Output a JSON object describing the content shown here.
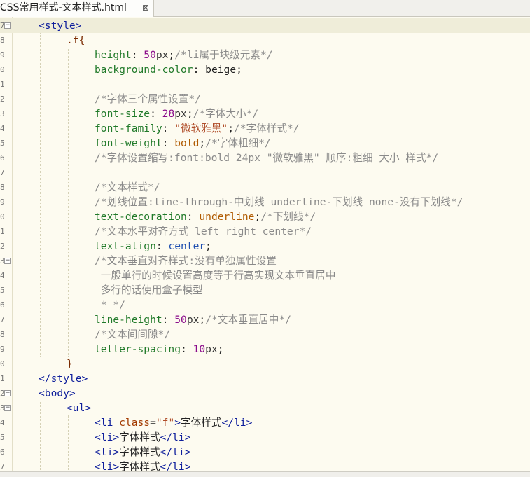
{
  "tab": {
    "title": "CSS常用样式-文本样式.html",
    "close": "⊠"
  },
  "lines": [
    [
      [
        "tag",
        "<style>"
      ]
    ],
    [
      [
        "sel",
        ".f{"
      ]
    ],
    [
      [
        "prop",
        "height"
      ],
      [
        "text",
        ": "
      ],
      [
        "num",
        "50"
      ],
      [
        "unit",
        "px"
      ],
      [
        "text",
        ";"
      ],
      [
        "com",
        "/*li属于块级元素*/"
      ]
    ],
    [
      [
        "prop",
        "background-color"
      ],
      [
        "text",
        ": "
      ],
      [
        "text",
        "beige;"
      ]
    ],
    [],
    [
      [
        "com",
        "/*字体三个属性设置*/"
      ]
    ],
    [
      [
        "prop",
        "font-size"
      ],
      [
        "text",
        ": "
      ],
      [
        "num",
        "28"
      ],
      [
        "unit",
        "px"
      ],
      [
        "text",
        ";"
      ],
      [
        "com",
        "/*字体大小*/"
      ]
    ],
    [
      [
        "prop",
        "font-family"
      ],
      [
        "text",
        ": "
      ],
      [
        "str",
        "\"微软雅黑\""
      ],
      [
        "text",
        ";"
      ],
      [
        "com",
        "/*字体样式*/"
      ]
    ],
    [
      [
        "prop",
        "font-weight"
      ],
      [
        "text",
        ": "
      ],
      [
        "kw",
        "bold"
      ],
      [
        "text",
        ";"
      ],
      [
        "com",
        "/*字体粗细*/"
      ]
    ],
    [
      [
        "com",
        "/*字体设置缩写:font:bold 24px \"微软雅黑\" 顺序:粗细 大小 样式*/"
      ]
    ],
    [],
    [
      [
        "com",
        "/*文本样式*/"
      ]
    ],
    [
      [
        "com",
        "/*划线位置:line-through-中划线 underline-下划线 none-没有下划线*/"
      ]
    ],
    [
      [
        "prop",
        "text-decoration"
      ],
      [
        "text",
        ": "
      ],
      [
        "kw",
        "underline"
      ],
      [
        "text",
        ";"
      ],
      [
        "com",
        "/*下划线*/"
      ]
    ],
    [
      [
        "com",
        "/*文本水平对齐方式 left right center*/"
      ]
    ],
    [
      [
        "prop",
        "text-align"
      ],
      [
        "text",
        ": "
      ],
      [
        "kw2",
        "center"
      ],
      [
        "text",
        ";"
      ]
    ],
    [
      [
        "com",
        "/*文本垂直对齐样式:没有单独属性设置"
      ]
    ],
    [
      [
        "com",
        " 一般单行的时候设置高度等于行高实现文本垂直居中"
      ]
    ],
    [
      [
        "com",
        " 多行的话使用盒子模型"
      ]
    ],
    [
      [
        "com",
        " * */"
      ]
    ],
    [
      [
        "prop",
        "line-height"
      ],
      [
        "text",
        ": "
      ],
      [
        "num",
        "50"
      ],
      [
        "unit",
        "px"
      ],
      [
        "text",
        ";"
      ],
      [
        "com",
        "/*文本垂直居中*/"
      ]
    ],
    [
      [
        "com",
        "/*文本间间隙*/"
      ]
    ],
    [
      [
        "prop",
        "letter-spacing"
      ],
      [
        "text",
        ": "
      ],
      [
        "num",
        "10"
      ],
      [
        "unit",
        "px"
      ],
      [
        "text",
        ";"
      ]
    ],
    [
      [
        "sel",
        "}"
      ]
    ],
    [
      [
        "tag",
        "</style>"
      ]
    ],
    [
      [
        "tag",
        "<body>"
      ]
    ],
    [
      [
        "tag",
        "<ul>"
      ]
    ],
    [
      [
        "tag",
        "<li "
      ],
      [
        "attr",
        "class"
      ],
      [
        "text",
        "="
      ],
      [
        "str",
        "\"f\""
      ],
      [
        "tag",
        ">"
      ],
      [
        "text",
        "字体样式"
      ],
      [
        "tag",
        "</li>"
      ]
    ],
    [
      [
        "tag",
        "<li>"
      ],
      [
        "text",
        "字体样式"
      ],
      [
        "tag",
        "</li>"
      ]
    ],
    [
      [
        "tag",
        "<li>"
      ],
      [
        "text",
        "字体样式"
      ],
      [
        "tag",
        "</li>"
      ]
    ],
    [
      [
        "tag",
        "<li>"
      ],
      [
        "text",
        "字体样式"
      ],
      [
        "tag",
        "</li>"
      ]
    ]
  ],
  "gutter_numbers": [
    "7",
    "8",
    "9",
    "0",
    "1",
    "2",
    "3",
    "4",
    "5",
    "6",
    "7",
    "8",
    "9",
    "0",
    "1",
    "2",
    "3",
    "4",
    "5",
    "6",
    "7",
    "8",
    "9",
    "0",
    "1",
    "2",
    "3",
    "4",
    "5",
    "6",
    "7"
  ],
  "fold_markers": [
    "⊟",
    "",
    "",
    "",
    "",
    "",
    "",
    "",
    "",
    "",
    "",
    "",
    "",
    "",
    "",
    "",
    "⊟",
    "",
    "",
    "",
    "",
    "",
    "",
    "",
    "",
    "⊟",
    "⊟",
    "",
    "",
    "",
    ""
  ]
}
